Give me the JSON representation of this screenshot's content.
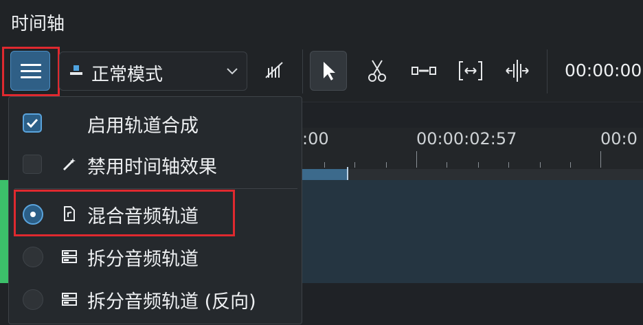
{
  "window": {
    "title": "时间轴"
  },
  "toolbar": {
    "mode_combo_value": "正常模式",
    "timecode": "00:00:00",
    "tools": [
      "spacer-icon",
      "select-icon",
      "razor-icon",
      "ripple-icon",
      "slip-icon",
      "slide-icon"
    ]
  },
  "ruler": {
    "timecodes": [
      ":00",
      "00:00:02:57",
      "00:0"
    ]
  },
  "menu": {
    "items": [
      {
        "label": "启用轨道合成",
        "control": "checkbox",
        "checked": true
      },
      {
        "label": "禁用时间轴效果",
        "control": "checkbox",
        "checked": false,
        "icon": "magic-wand-icon"
      },
      {
        "label": "混合音频轨道",
        "control": "radio",
        "checked": true,
        "icon": "audio-file-icon"
      },
      {
        "label": "拆分音频轨道",
        "control": "radio",
        "checked": false,
        "icon": "split-tracks-icon"
      },
      {
        "label": "拆分音频轨道 (反向)",
        "control": "radio",
        "checked": false,
        "icon": "split-tracks-icon"
      }
    ]
  },
  "colors": {
    "accent": "#2f5f86",
    "highlight": "#e0292f",
    "track": "#3cc06a"
  }
}
